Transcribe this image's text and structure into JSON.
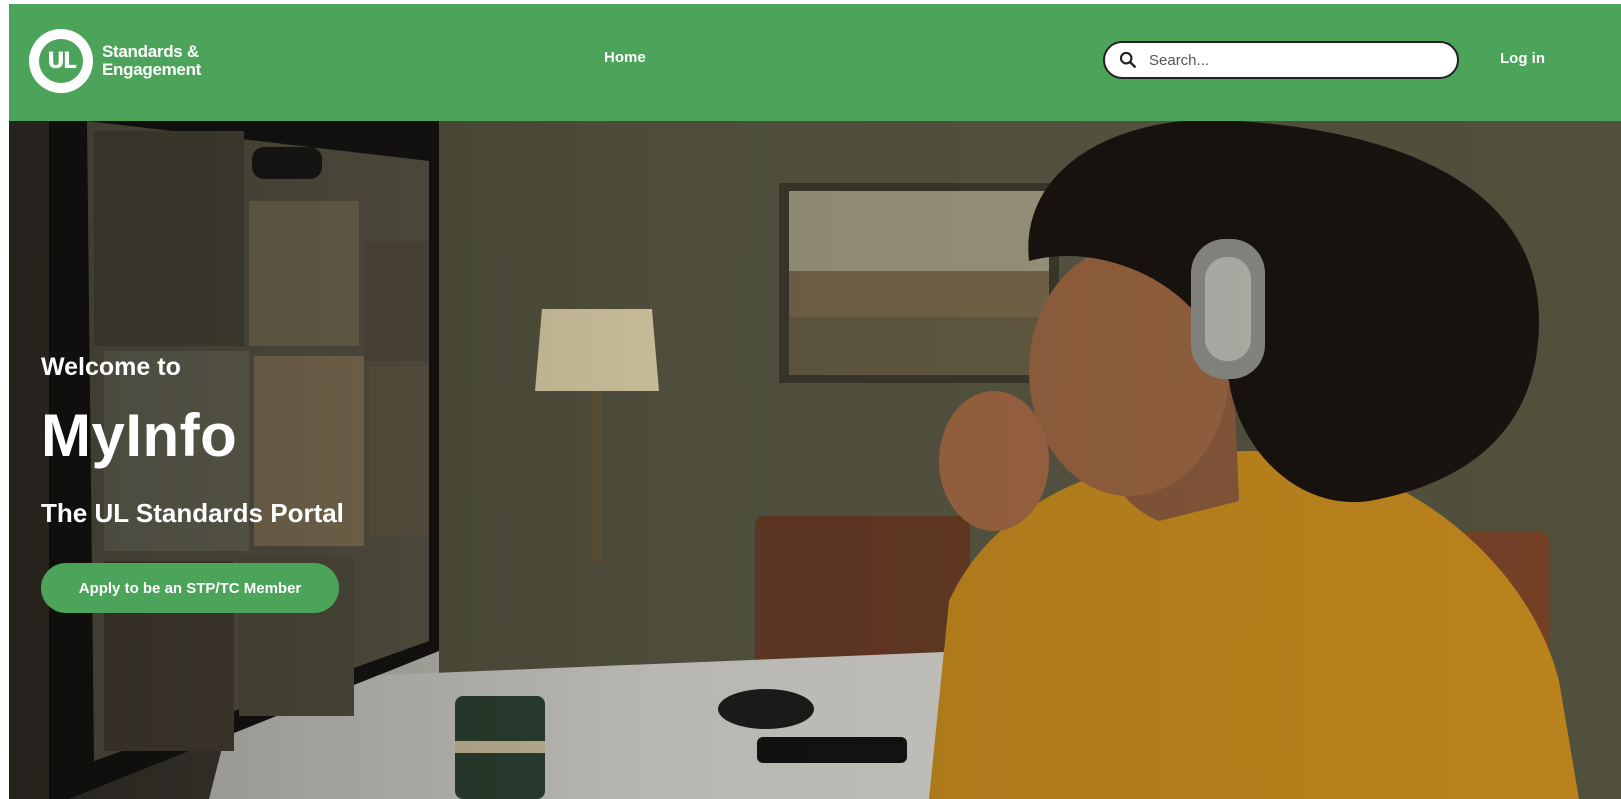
{
  "header": {
    "logo_line1": "Standards &",
    "logo_line2": "Engagement",
    "logo_mark": "UL",
    "nav_home": "Home",
    "search_placeholder": "Search...",
    "login": "Log in",
    "brand_color": "#4ca35a"
  },
  "hero": {
    "welcome": "Welcome to",
    "title": "MyInfo",
    "subtitle": "The UL Standards Portal",
    "cta_label": "Apply to be an STP/TC Member"
  },
  "icons": {
    "search": "search-icon",
    "logo": "ul-logo-icon"
  }
}
